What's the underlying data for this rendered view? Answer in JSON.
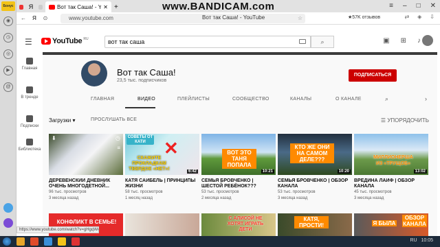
{
  "browser": {
    "sidebar_logo": "Бонус",
    "tab_pinned_1": "Я",
    "active_tab_title": "Вот так Саша! - YouTub",
    "recording_watermark": "www.BANDICAM.com",
    "url": "www.youtube.com",
    "window_title": "Вот так Саша! - YouTube",
    "reviews": "★57K отзывов",
    "status_url": "https://www.youtube.com/watch?v=gHgqWeakyV"
  },
  "youtube": {
    "logo_text": "YouTube",
    "logo_region": "RU",
    "search_value": "вот так саша",
    "nav": [
      {
        "label": "Главная",
        "icon": "home-icon"
      },
      {
        "label": "В тренде",
        "icon": "fire-icon"
      },
      {
        "label": "Подписки",
        "icon": "subscriptions-icon"
      },
      {
        "label": "Библиотека",
        "icon": "library-icon"
      }
    ]
  },
  "channel": {
    "name": "Вот так Саша!",
    "subscribers": "23,5 тыс. подписчиков",
    "subscribe_label": "ПОДПИСАТЬСЯ",
    "tabs": [
      "ГЛАВНАЯ",
      "ВИДЕО",
      "ПЛЕЙЛИСТЫ",
      "СООБЩЕСТВО",
      "КАНАЛЫ",
      "О КАНАЛЕ"
    ],
    "active_tab": "ВИДЕО"
  },
  "filter": {
    "uploads_label": "Загрузки",
    "play_all_label": "ПРОСЛУШАТЬ ВСЕ",
    "sort_label": "УПОРЯДОЧИТЬ"
  },
  "videos": [
    {
      "title": "ДЕРЕВЕНСКИЙ ДНЕВНИК ОЧЕНЬ МНОГОДЕТНОЙ...",
      "views": "96 тыс. просмотров",
      "age": "3 месяца назад",
      "duration": "",
      "caption": ""
    },
    {
      "title": "КАТЯ САЙБЕЛЬ | ПРИНЦИПЫ ЖИЗНИ",
      "views": "58 тыс. просмотров",
      "age": "1 месяц назад",
      "duration": "6:42",
      "caption": "СКАЖИТЕ ПРОКЛАДКАМ ТВЕРДОЕ «НЕТ»!",
      "badge": "СОВЕТЫ ОТ КАТИ"
    },
    {
      "title": "СЕМЬЯ БРОВЧЕНКО | ШЕСТОЙ РЕБЁНОК???",
      "views": "53 тыс. просмотров",
      "age": "2 месяца назад",
      "duration": "10:21",
      "caption": "ВОТ ЭТО ТАНЯ ПОПАЛА"
    },
    {
      "title": "СЕМЬЯ БРОВЧЕНКО | ОБЗОР КАНАЛА",
      "views": "53 тыс. просмотров",
      "age": "3 месяца назад",
      "duration": "10:20",
      "caption": "КТО ЖЕ ОНИ НА САМОМ ДЕЛЕ???"
    },
    {
      "title": "ВРЕДИНА ЛАЙФ | ОБЗОР КАНАЛА",
      "views": "45 тыс. просмотров",
      "age": "3 месяца назад",
      "duration": "13:02",
      "caption": "МИЛЛИОНЕРША ИЗ «ТРУЩОБ»"
    }
  ],
  "row2_captions": [
    "КОНФЛИКТ В СЕМЬЕ!",
    "",
    "С АЛИСОЙ НЕ ХОТЯТ ИГРАТЬ ДЕТИ",
    "КАТЯ, ПРОСТИ!",
    "Я БЫЛА",
    "ОБЗОР КАНАЛА"
  ],
  "taskbar": {
    "lang": "RU",
    "time": "10:05"
  },
  "colors": {
    "accent": "#cc0000",
    "caption_orange": "#ff8a00",
    "caption_yellow": "#ffd400"
  }
}
